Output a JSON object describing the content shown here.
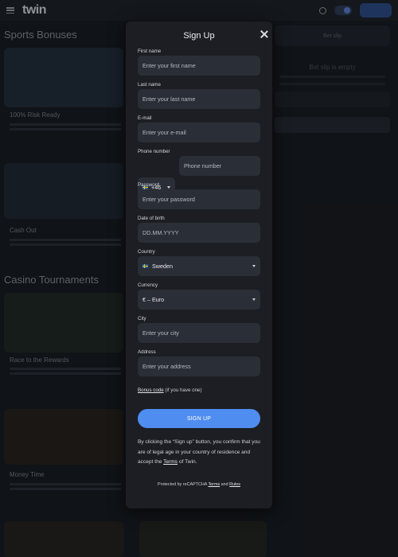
{
  "modal": {
    "title": "Sign Up",
    "fields": {
      "first_name": {
        "label": "First name",
        "placeholder": "Enter your first name"
      },
      "last_name": {
        "label": "Last name",
        "placeholder": "Enter your last name"
      },
      "email": {
        "label": "E-mail",
        "placeholder": "Enter your e-mail"
      },
      "phone": {
        "label": "Phone number",
        "code": "+46",
        "placeholder": "Phone number"
      },
      "password": {
        "label": "Password",
        "placeholder": "Enter your password"
      },
      "dob": {
        "label": "Date of birth",
        "placeholder": "DD.MM.YYYY"
      },
      "country": {
        "label": "Country",
        "value": "Sweden"
      },
      "currency": {
        "label": "Currency",
        "value": "€ – Euro"
      },
      "city": {
        "label": "City",
        "placeholder": "Enter your city"
      },
      "address": {
        "label": "Address",
        "placeholder": "Enter your address"
      }
    },
    "bonus": {
      "link": "Bonus code",
      "hint": "(if you have one)"
    },
    "signup_button": "SIGN UP",
    "disclaimer": {
      "before": "By clicking the “Sign up” button, you confirm that you are of legal age in your country of residence and accept the ",
      "terms_link": "Terms",
      "after": " of Twin."
    },
    "recaptcha": {
      "before": "Protected by reCAPTCHA ",
      "terms_link": "Terms",
      "and": " and ",
      "rules_link": "Rules"
    }
  },
  "background": {
    "logo": "twin",
    "sections": [
      "Sports Bonuses",
      "Casino Tournaments"
    ],
    "cards": [
      "100% Risk Ready",
      "Cash Out",
      "Race to the Rewards",
      "Money Time"
    ],
    "betslip": {
      "title": "Bet slip",
      "empty": "Bet slip is empty"
    }
  },
  "colors": {
    "accent": "#4f8df0",
    "modal_bg": "#1c1e23",
    "field_bg": "#2a2e37"
  }
}
